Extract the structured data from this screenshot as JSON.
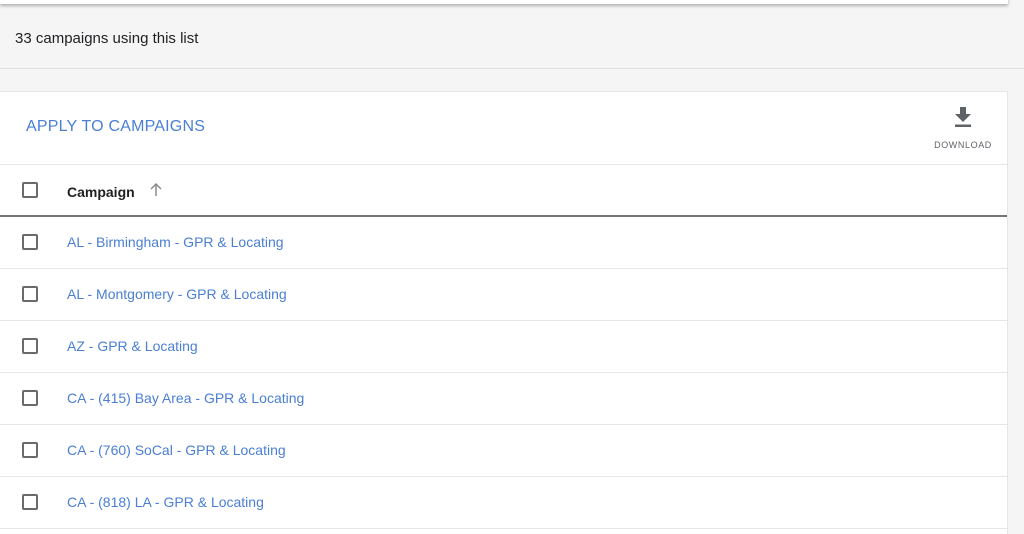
{
  "summary": {
    "text": "33 campaigns using this list"
  },
  "toolbar": {
    "apply_label": "APPLY TO CAMPAIGNS",
    "download_label": "DOWNLOAD",
    "download_icon": "download-icon"
  },
  "table": {
    "header": {
      "campaign": "Campaign",
      "sort_icon": "arrow-up-icon"
    },
    "rows": [
      {
        "campaign": "AL - Birmingham - GPR & Locating"
      },
      {
        "campaign": "AL - Montgomery - GPR & Locating"
      },
      {
        "campaign": "AZ - GPR & Locating"
      },
      {
        "campaign": "CA - (415) Bay Area - GPR & Locating"
      },
      {
        "campaign": "CA - (760) SoCal - GPR & Locating"
      },
      {
        "campaign": "CA - (818) LA - GPR & Locating"
      }
    ]
  },
  "colors": {
    "link": "#4a7fd4",
    "text": "#212121",
    "background": "#f5f5f5"
  }
}
